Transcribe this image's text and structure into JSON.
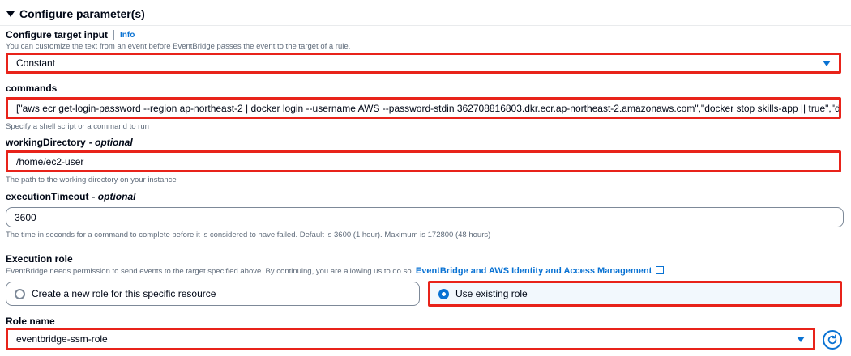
{
  "section": {
    "title": "Configure parameter(s)"
  },
  "target_input": {
    "label": "Configure target input",
    "info_link": "Info",
    "description": "You can customize the text from an event before EventBridge passes the event to the target of a rule.",
    "selected_value": "Constant"
  },
  "commands": {
    "label": "commands",
    "value": "[\"aws ecr get-login-password --region ap-northeast-2 | docker login --username AWS --password-stdin 362708816803.dkr.ecr.ap-northeast-2.amazonaws.com\",\"docker stop skills-app || true\",\"docker rm",
    "description": "Specify a shell script or a command to run"
  },
  "working_directory": {
    "label": "workingDirectory",
    "optional": "- optional",
    "value": "/home/ec2-user",
    "description": "The path to the working directory on your instance"
  },
  "execution_timeout": {
    "label": "executionTimeout",
    "optional": "- optional",
    "value": "3600",
    "description": "The time in seconds for a command to complete before it is considered to have failed. Default is 3600 (1 hour). Maximum is 172800 (48 hours)"
  },
  "execution_role": {
    "label": "Execution role",
    "description": "EventBridge needs permission to send events to the target specified above. By continuing, you are allowing us to do so.",
    "link_text": "EventBridge and AWS Identity and Access Management",
    "options": [
      {
        "label": "Create a new role for this specific resource",
        "selected": false
      },
      {
        "label": "Use existing role",
        "selected": true
      }
    ]
  },
  "role_name": {
    "label": "Role name",
    "selected_value": "eventbridge-ssm-role"
  },
  "icons": {
    "caret": "caret-down-icon",
    "select_arrow": "dropdown-arrow-icon",
    "external_link": "external-link-icon",
    "refresh": "refresh-icon"
  },
  "colors": {
    "accent": "#0972d3",
    "highlight": "#e8231a",
    "text": "#000716",
    "secondary_text": "#5f6b7a"
  }
}
